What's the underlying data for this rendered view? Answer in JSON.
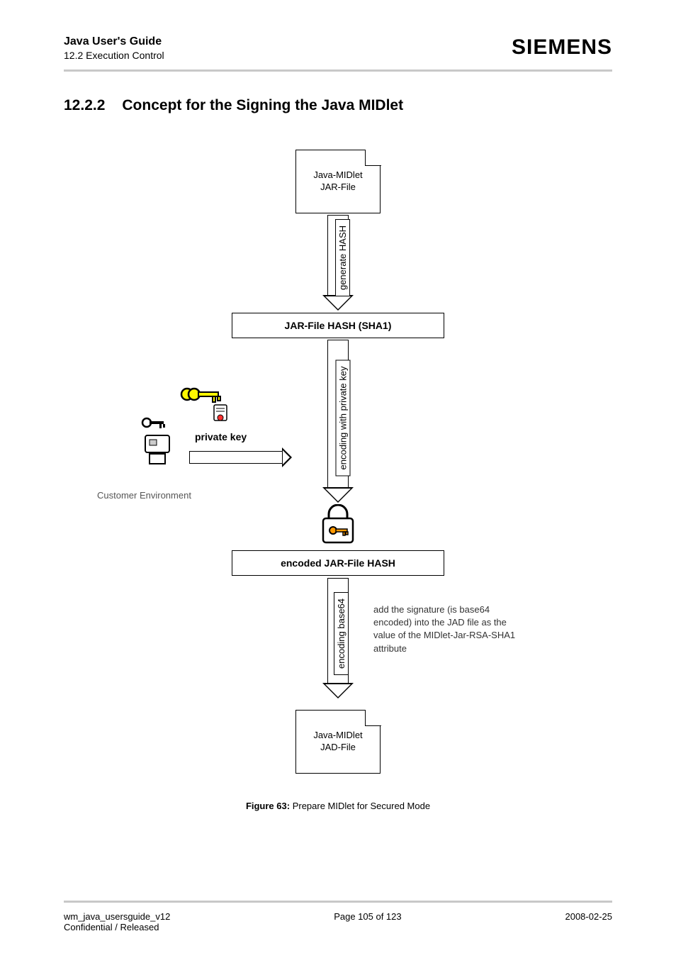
{
  "header": {
    "guide_title": "Java User's Guide",
    "guide_sub": "12.2 Execution Control",
    "brand": "SIEMENS"
  },
  "section": {
    "number": "12.2.2",
    "title": "Concept for the Signing the Java MIDlet"
  },
  "diagram": {
    "jar_file": "Java-MIDlet\nJAR-File",
    "arrow1_label": "generate HASH",
    "hash_box": "JAR-File HASH (SHA1)",
    "arrow2_label": "encoding with private key",
    "private_key_label": "private key",
    "customer_env": "Customer Environment",
    "encoded_box": "encoded JAR-File HASH",
    "arrow3_label": "encoding base64",
    "side_note": "add the signature (is base64 encoded) into the JAD file as the value of the MIDlet-Jar-RSA-SHA1 attribute",
    "jad_file": "Java-MIDlet\nJAD-File"
  },
  "caption": {
    "label": "Figure 63:",
    "text": "Prepare MIDlet for Secured Mode"
  },
  "footer": {
    "doc_id": "wm_java_usersguide_v12",
    "classification": "Confidential / Released",
    "page": "Page 105 of 123",
    "date": "2008-02-25"
  }
}
